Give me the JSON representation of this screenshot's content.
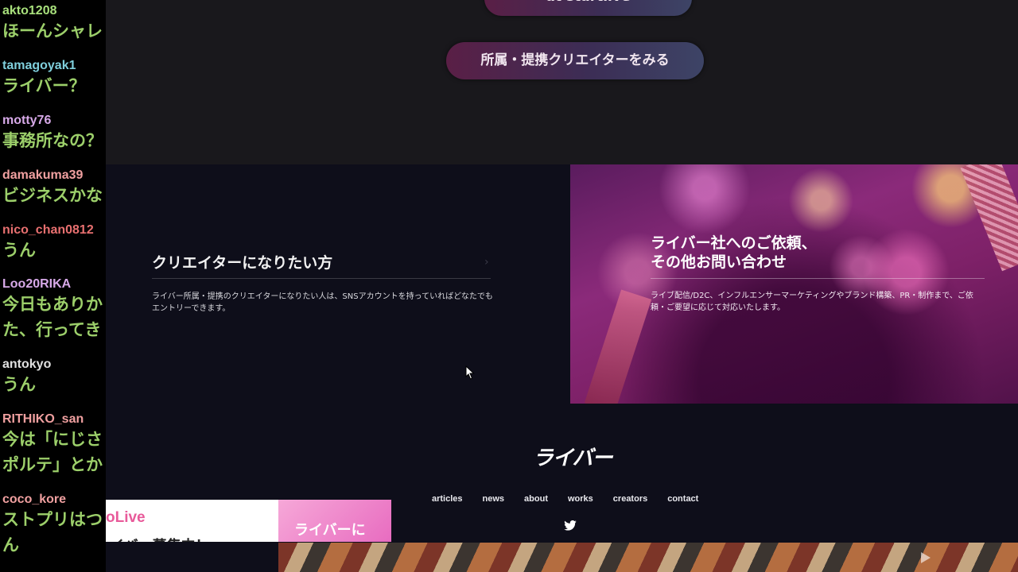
{
  "chat": {
    "messages": [
      {
        "user": "akto1208",
        "user_color": "#a8e07c",
        "text": "ほーんシャレ"
      },
      {
        "user": "tamagoyak1",
        "user_color": "#7fcfdc",
        "text": "ライバー？"
      },
      {
        "user": "motty76",
        "user_color": "#d7a9e8",
        "text": "事務所なの？"
      },
      {
        "user": "damakuma39",
        "user_color": "#f0a0a0",
        "text": "ビジネスかな"
      },
      {
        "user": "nico_chan0812",
        "user_color": "#e87070",
        "text": "うん"
      },
      {
        "user": "Loo20RIKA",
        "user_color": "#d7a9e8",
        "text": "今日もありか\nた、行ってき"
      },
      {
        "user": "antokyo",
        "user_color": "#e0e0e0",
        "text": "うん"
      },
      {
        "user": "RITHIKO_san",
        "user_color": "#f0a0a0",
        "text": "今は「にじさ\nポルテ」とか"
      },
      {
        "user": "coco_kore",
        "user_color": "#f0a0a0",
        "text": "ストプリはつ\nん"
      }
    ]
  },
  "site": {
    "top_button_label": "at startlive",
    "creators_button_label": "所属・提携クリエイターをみる",
    "creator_panel": {
      "title": "クリエイターになりたい方",
      "arrow": "›",
      "description": "ライバー所属・提携のクリエイターになりたい人は、SNSアカウントを持っていればどなたでもエントリーできます。"
    },
    "contact_panel": {
      "title_line1": "ライバー社へのご依頼、",
      "title_line2": "その他お問い合わせ",
      "description": "ライブ配信/D2C、インフルエンサーマーケティングやブランド構築、PR・制作まで、ご依頼・ご要望に応じて対応いたします。"
    },
    "footer": {
      "logo": "ライバー",
      "nav": [
        "articles",
        "news",
        "about",
        "works",
        "creators",
        "contact"
      ],
      "social_icon": "twitter-icon"
    }
  },
  "overlay": {
    "ad_left_title": "oLive",
    "ad_left_sub": "イバー募集中！",
    "ad_right_text": "ライバーに"
  },
  "colors": {
    "chat_text": "#9ccf6a",
    "site_bg": "#0e0e1a",
    "accent_pink": "#e85a9a"
  }
}
